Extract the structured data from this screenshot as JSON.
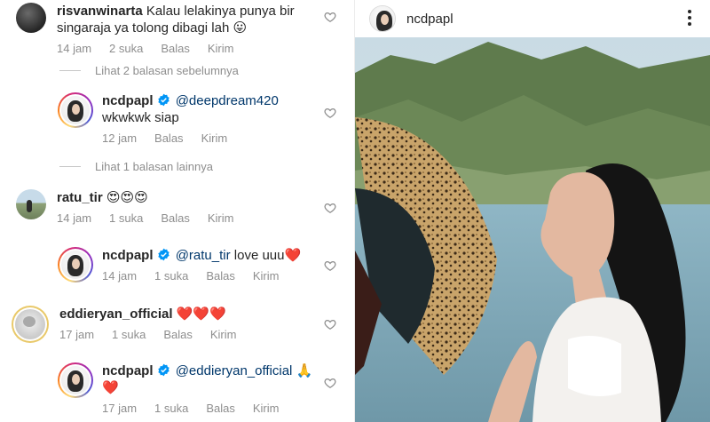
{
  "comments": [
    {
      "id": "risvan",
      "username": "risvanwinarta",
      "text": "Kalau lelakinya punya bir singaraja ya tolong dibagi lah",
      "emoji": "😛",
      "time": "14 jam",
      "likes": "2 suka",
      "reply_label": "Balas",
      "send_label": "Kirim"
    },
    {
      "id": "ncd-reply-1",
      "username": "ncdpapl",
      "verified": true,
      "mention": "@deepdream420",
      "text": "wkwkwk siap",
      "time": "12 jam",
      "reply_label": "Balas",
      "send_label": "Kirim"
    },
    {
      "id": "ratu",
      "username": "ratu_tir",
      "emoji": "😍😍😍",
      "time": "14 jam",
      "likes": "1 suka",
      "reply_label": "Balas",
      "send_label": "Kirim"
    },
    {
      "id": "ncd-reply-2",
      "username": "ncdpapl",
      "verified": true,
      "mention": "@ratu_tir",
      "text": "love uuu",
      "emoji": "❤️",
      "time": "14 jam",
      "likes": "1 suka",
      "reply_label": "Balas",
      "send_label": "Kirim"
    },
    {
      "id": "eddie",
      "username": "eddieryan_official",
      "emoji": "❤️❤️❤️",
      "time": "17 jam",
      "likes": "1 suka",
      "reply_label": "Balas",
      "send_label": "Kirim"
    },
    {
      "id": "ncd-reply-3",
      "username": "ncdpapl",
      "verified": true,
      "mention": "@eddieryan_official",
      "emoji": "🙏",
      "emoji_line2": "❤️",
      "time": "17 jam",
      "likes": "1 suka",
      "reply_label": "Balas",
      "send_label": "Kirim"
    }
  ],
  "toggles": {
    "previous_replies": "Lihat 2 balasan sebelumnya",
    "other_replies": "Lihat 1 balasan lainnya"
  },
  "post": {
    "username": "ncdpapl"
  },
  "colors": {
    "text": "#262626",
    "secondary": "#8e8e8e",
    "mention": "#00376b",
    "verified": "#0095f6",
    "heart": "#e0191d"
  },
  "icons": [
    "heart-outline-icon",
    "verified-badge-icon",
    "more-options-icon"
  ]
}
